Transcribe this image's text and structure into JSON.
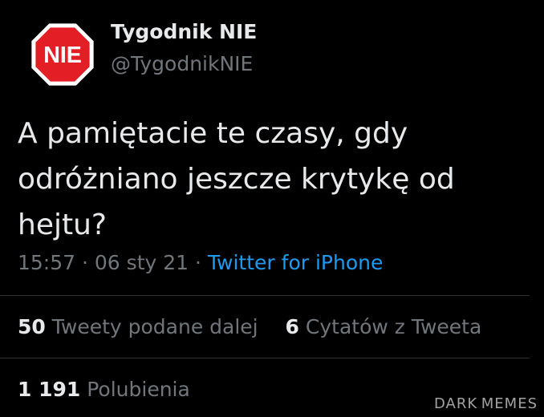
{
  "account": {
    "display_name": "Tygodnik NIE",
    "handle": "@TygodnikNIE",
    "avatar_text": "NIE",
    "avatar_color": "#e31e24"
  },
  "tweet": {
    "text_line1": "A pamiętacie te czasy, gdy",
    "text_line2": "odróżniano jeszcze krytykę od",
    "text_line3": "hejtu?",
    "time": "15:57",
    "separator1": "·",
    "date": "06 sty 21",
    "separator2": "·",
    "source": "Twitter for iPhone",
    "source_color": "#1d9bf0"
  },
  "stats": {
    "retweets_count": "50",
    "retweets_label": "Tweety podane dalej",
    "quotes_count": "6",
    "quotes_label": "Cytatów z Tweeta",
    "likes_count": "1 191",
    "likes_label": "Polubienia"
  },
  "watermark": {
    "text": "DARK MEMES"
  }
}
